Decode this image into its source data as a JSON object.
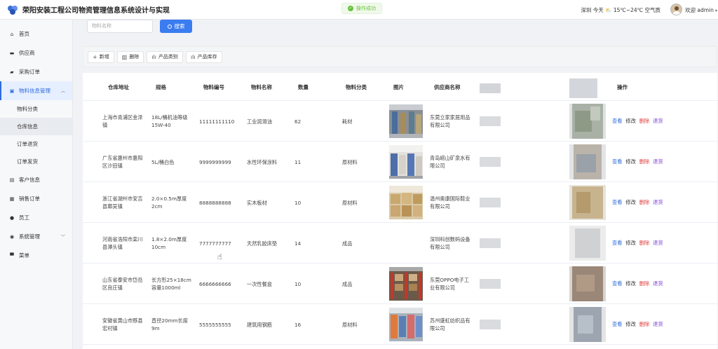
{
  "app": {
    "title": "荣阳安装工程公司物资管理信息系统设计与实现"
  },
  "toast": {
    "text": "操作成功"
  },
  "header": {
    "weather": "深圳 今天 ⛅ 15℃~24℃ 空气质",
    "user": "欢迎 admin"
  },
  "sidebar": {
    "items": [
      {
        "label": "首页",
        "icon": "home-icon"
      },
      {
        "label": "供应商",
        "icon": "supplier-icon"
      },
      {
        "label": "采购订单",
        "icon": "purchase-icon"
      },
      {
        "label": "物料信息管理",
        "icon": "material-icon"
      },
      {
        "label": "客户信息",
        "icon": "customer-icon"
      },
      {
        "label": "销售订单",
        "icon": "sales-icon"
      },
      {
        "label": "员工",
        "icon": "employee-icon"
      },
      {
        "label": "系统管理",
        "icon": "settings-icon"
      },
      {
        "label": "菜单",
        "icon": "menu-icon"
      }
    ],
    "sub": [
      {
        "label": "物料分类"
      },
      {
        "label": "仓库信息"
      },
      {
        "label": "订单退货"
      },
      {
        "label": "订单发货"
      }
    ]
  },
  "search": {
    "placeholder": "物料名称",
    "button": "搜索"
  },
  "toolbar": {
    "add": "新增",
    "delete": "删除",
    "category": "产品类别",
    "stock": "产品库存"
  },
  "table": {
    "headers": {
      "address": "仓库地址",
      "spec": "规格",
      "code": "物料编号",
      "name": "物料名称",
      "qty": "数量",
      "category": "物料分类",
      "photo": "图片",
      "supplier": "供应商名称",
      "actions": "操作"
    },
    "rows": [
      {
        "address": "上海市青浦区金泽镇",
        "spec": "18L/桶机油等级15W-40",
        "code": "11111111110",
        "name": "工业润滑油",
        "qty": "62",
        "category": "耗材",
        "supplier": "东莞立家家居用品有限公司"
      },
      {
        "address": "广东省惠州市惠阳区沙田镇",
        "spec": "5L/桶白色",
        "code": "9999999999",
        "name": "水性环保涂料",
        "qty": "11",
        "category": "原材料",
        "supplier": "青岛崂山矿泉水有限公司"
      },
      {
        "address": "浙江省湖州市安吉县鄣吴镇",
        "spec": "2.0×0.5m厚度2cm",
        "code": "8888888888",
        "name": "实木板材",
        "qty": "10",
        "category": "原材料",
        "supplier": "温州奥康国际鞋业有限公司"
      },
      {
        "address": "河南省洛阳市栾川县潭头镇",
        "spec": "1.8×2.0m厚度10cm",
        "code": "7777777777",
        "name": "天然乳胶床垫",
        "qty": "14",
        "category": "成品",
        "supplier": "深圳科创数码设备有限公司"
      },
      {
        "address": "山东省泰安市岱岳区良庄镇",
        "spec": "长方形25×18cm容量1000ml",
        "code": "6666666666",
        "name": "一次性餐盒",
        "qty": "10",
        "category": "成品",
        "supplier": "东莞OPPO电子工业有限公司"
      },
      {
        "address": "安徽省黄山市黟县宏村镇",
        "spec": "直径20mm长度9m",
        "code": "5555555555",
        "name": "建筑用钢筋",
        "qty": "16",
        "category": "原材料",
        "supplier": "苏州盛虹纺织品有限公司"
      }
    ],
    "ops": {
      "view": "查看",
      "edit": "修改",
      "delete": "删除",
      "return": "退货"
    }
  }
}
